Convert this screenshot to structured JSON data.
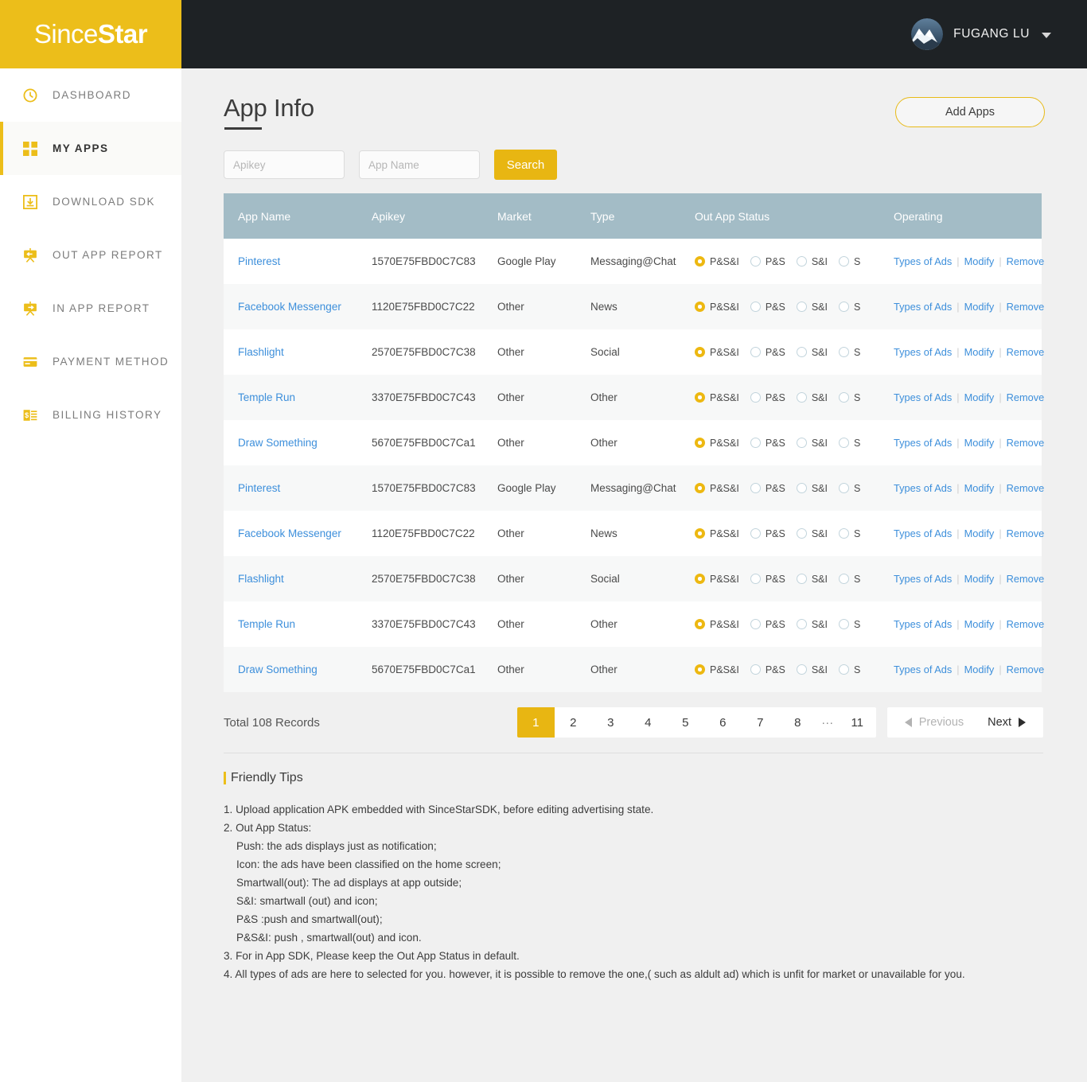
{
  "brand": {
    "part1": "Since",
    "part2": "Star"
  },
  "header": {
    "username": "FUGANG LU",
    "avatar_icon": "mountain-avatar",
    "caret_icon": "chevron-down-icon"
  },
  "colors": {
    "brand_yellow": "#ecbe1a",
    "accent_gold": "#e8b612",
    "table_header": "#a3bcc6",
    "link_blue": "#3d8fdb",
    "dark_bar": "#1e2225"
  },
  "sidebar": {
    "items": [
      {
        "label": "DASHBOARD",
        "icon": "dashboard-clock-icon",
        "active": false
      },
      {
        "label": "MY APPS",
        "icon": "grid-squares-icon",
        "active": true
      },
      {
        "label": "DOWNLOAD SDK",
        "icon": "download-box-icon",
        "active": false
      },
      {
        "label": "OUT APP REPORT",
        "icon": "board-left-arrow-icon",
        "active": false
      },
      {
        "label": "IN APP REPORT",
        "icon": "board-right-arrow-icon",
        "active": false
      },
      {
        "label": "PAYMENT METHOD",
        "icon": "credit-card-icon",
        "active": false
      },
      {
        "label": "BILLING HISTORY",
        "icon": "invoice-dollar-icon",
        "active": false
      }
    ]
  },
  "page": {
    "title": "App Info",
    "add_apps_label": "Add Apps"
  },
  "search": {
    "apikey_placeholder": "Apikey",
    "apikey_value": "",
    "appname_placeholder": "App Name",
    "appname_value": "",
    "search_label": "Search"
  },
  "table": {
    "columns": [
      "App Name",
      "Apikey",
      "Market",
      "Type",
      "Out App Status",
      "Operating"
    ],
    "status_options": [
      "P&S&I",
      "P&S",
      "S&I",
      "S"
    ],
    "operations": [
      "Types of Ads",
      "Modify",
      "Remove"
    ],
    "separator": "|",
    "rows": [
      {
        "app": "Pinterest",
        "apikey": "1570E75FBD0C7C83",
        "market": "Google Play",
        "type": "Messaging@Chat",
        "selected": 0
      },
      {
        "app": "Facebook Messenger",
        "apikey": "1120E75FBD0C7C22",
        "market": "Other",
        "type": "News",
        "selected": 0
      },
      {
        "app": "Flashlight",
        "apikey": "2570E75FBD0C7C38",
        "market": "Other",
        "type": "Social",
        "selected": 0
      },
      {
        "app": "Temple Run",
        "apikey": "3370E75FBD0C7C43",
        "market": "Other",
        "type": "Other",
        "selected": 0
      },
      {
        "app": "Draw Something",
        "apikey": "5670E75FBD0C7Ca1",
        "market": "Other",
        "type": "Other",
        "selected": 0
      },
      {
        "app": "Pinterest",
        "apikey": "1570E75FBD0C7C83",
        "market": "Google Play",
        "type": "Messaging@Chat",
        "selected": 0
      },
      {
        "app": "Facebook Messenger",
        "apikey": "1120E75FBD0C7C22",
        "market": "Other",
        "type": "News",
        "selected": 0
      },
      {
        "app": "Flashlight",
        "apikey": "2570E75FBD0C7C38",
        "market": "Other",
        "type": "Social",
        "selected": 0
      },
      {
        "app": "Temple Run",
        "apikey": "3370E75FBD0C7C43",
        "market": "Other",
        "type": "Other",
        "selected": 0
      },
      {
        "app": "Draw Something",
        "apikey": "5670E75FBD0C7Ca1",
        "market": "Other",
        "type": "Other",
        "selected": 0
      }
    ]
  },
  "pagination": {
    "total_text": "Total 108 Records",
    "pages": [
      "1",
      "2",
      "3",
      "4",
      "5",
      "6",
      "7",
      "8",
      "···",
      "11"
    ],
    "current": "1",
    "ellipsis": "···",
    "previous_label": "Previous",
    "next_label": "Next",
    "previous_enabled": false,
    "next_enabled": true
  },
  "tips": {
    "title": "Friendly Tips",
    "lines": [
      {
        "text": "1. Upload application APK embedded with SinceStarSDK, before editing advertising state.",
        "indent": false
      },
      {
        "text": "2. Out App Status:",
        "indent": false
      },
      {
        "text": "Push: the ads displays just as notification;",
        "indent": true
      },
      {
        "text": "Icon: the ads have been classified on the home screen;",
        "indent": true
      },
      {
        "text": "Smartwall(out): The ad displays at app outside;",
        "indent": true
      },
      {
        "text": "S&I: smartwall (out) and icon;",
        "indent": true
      },
      {
        "text": "P&S :push and smartwall(out);",
        "indent": true
      },
      {
        "text": "P&S&I: push , smartwall(out) and icon.",
        "indent": true
      },
      {
        "text": "3. For in App SDK, Please keep the Out App Status in default.",
        "indent": false
      },
      {
        "text": "4. All types of ads are here to selected for you. however, it is possible to remove the one,( such as aldult ad) which is unfit for market or unavailable for you.",
        "indent": false
      }
    ]
  }
}
